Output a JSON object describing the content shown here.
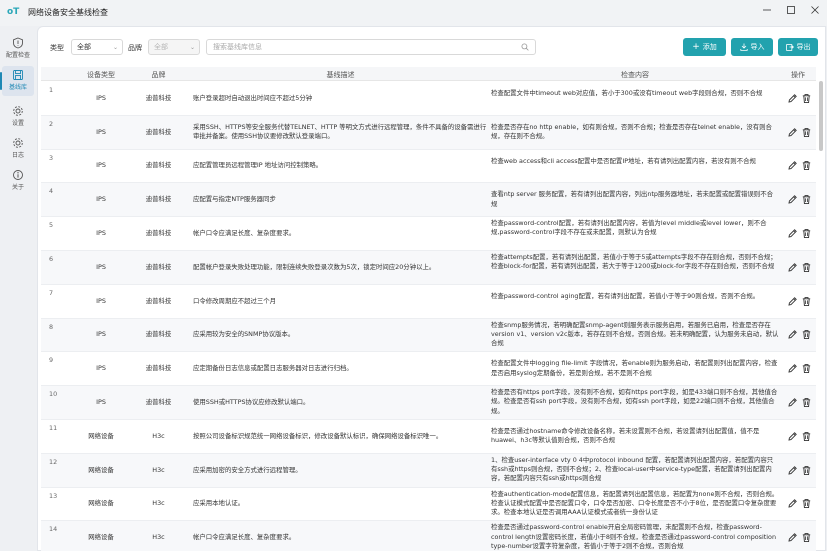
{
  "app": {
    "logo_text": "oT",
    "title": "网络设备安全基线检查"
  },
  "sidebar": {
    "items": [
      {
        "label": "配置检查",
        "icon": "shield-icon",
        "active": false
      },
      {
        "label": "基线库",
        "icon": "save-icon",
        "active": true
      },
      {
        "label": "设置",
        "icon": "gear-icon",
        "active": false
      },
      {
        "label": "日志",
        "icon": "gear-log-icon",
        "active": false
      },
      {
        "label": "关于",
        "icon": "info-icon",
        "active": false
      }
    ]
  },
  "filters": {
    "type_label": "类型",
    "type_value": "全部",
    "brand_label": "品牌",
    "brand_value": "全部",
    "search_placeholder": "搜索基线库信息"
  },
  "toolbar": {
    "add_label": "添加",
    "import_label": "导入",
    "export_label": "导出"
  },
  "colors": {
    "accent": "#22a2ae"
  },
  "table": {
    "headers": [
      "设备类型",
      "品牌",
      "基线描述",
      "检查内容",
      "操作"
    ],
    "rows": [
      {
        "idx": "1",
        "type": "IPS",
        "brand": "迪普科技",
        "desc": "账户登录超时自动退出时间应不超过5分钟",
        "check": "检查配置文件中timeout web对应值，若小于300或没有timeout web字段则合规，否则不合规"
      },
      {
        "idx": "2",
        "type": "IPS",
        "brand": "迪普科技",
        "desc": "采用SSH、HTTPS等安全服务代替TELNET、HTTP 等明文方式进行远程管理，条件不具备的设备需进行审批并备案。使用SSH协议要修改默认登录端口。",
        "check": "检查是否存在no http enable，如有则合规，否则不合规；检查是否存在telnet enable，没有则合规，存在则不合规。"
      },
      {
        "idx": "3",
        "type": "IPS",
        "brand": "迪普科技",
        "desc": "应配置管理员远程管理IP 地址访问控制策略。",
        "check": "检查web access和cli access配置中是否配置IP地址，若有请列出配置内容，若没有则不合规"
      },
      {
        "idx": "4",
        "type": "IPS",
        "brand": "迪普科技",
        "desc": "应配置与指定NTP服务器同步",
        "check": "查看ntp server 服务配置，若有请列出配置内容，列出ntp服务器地址，若未配置或配置错误则不合规"
      },
      {
        "idx": "5",
        "type": "IPS",
        "brand": "迪普科技",
        "desc": "帐户口令应满足长度、复杂度要求。",
        "check": "检查password-control配置，若有请列出配置内容，若值为level middle或level lower，则不合规,password-control字段不存在或未配置，则默认为合规"
      },
      {
        "idx": "6",
        "type": "IPS",
        "brand": "迪普科技",
        "desc": "配置帐户登录失败处理功能，限制连续失败登录次数为5次，锁定时间应20分钟以上。",
        "check": "检查attempts配置，若有请列出配置，若值小于等于5或attempts字段不存在则合规，否则不合规；检查block-for配置，若有请列出配置，若大于等于1200或block-for字段不存在则合规，否则不合规"
      },
      {
        "idx": "7",
        "type": "IPS",
        "brand": "迪普科技",
        "desc": "口令修改周期应不超过三个月",
        "check": "检查password-control aging配置，若有请列出配置，若值小于等于90则合规，否则不合规。"
      },
      {
        "idx": "8",
        "type": "IPS",
        "brand": "迪普科技",
        "desc": "应采用较为安全的SNMP协议版本。",
        "check": "检查snmp服务情况，若明确配置snmp-agent则服务表示服务启用，若服务已启用，检查是否存在version v1、version v2c版本，若存在则不合规，否则合规。若未明确配置，认为服务未启动，默认合规"
      },
      {
        "idx": "9",
        "type": "IPS",
        "brand": "迪普科技",
        "desc": "应定期备份日志信息或配置日志服务器对日志进行归档。",
        "check": "检查配置文件中logging file-limit 字段情况，若enable则为服务启动，若配置则列出配置内容，检查是否启用syslog定期备份，若是则合规，若不是则不合规"
      },
      {
        "idx": "10",
        "type": "IPS",
        "brand": "迪普科技",
        "desc": "使用SSH或HTTPS协议应修改默认端口。",
        "check": "检查是否有https port字段，没有则不合规，如有https port字段，如是433端口则不合规，其他值合规。检查是否有ssh port字段，没有则不合规，如有ssh port字段，如是22端口则不合规，其他值合规。"
      },
      {
        "idx": "11",
        "type": "网络设备",
        "brand": "H3c",
        "desc": "按照公司设备标识规范统一网络设备标识，修改设备默认标识，确保网络设备标识唯一。",
        "check": "检查是否通过hostname命令修改设备名称，若未设置则不合规，若设置请列出配置值，值不是huawei、h3c等默认值则合规，否则不合规"
      },
      {
        "idx": "12",
        "type": "网络设备",
        "brand": "H3c",
        "desc": "应采用加密的安全方式进行远程管理。",
        "check": "1、检查user-interface vty 0 4中protocol inbound 配置，若配置请列出配置内容，若配置内容只有ssh或https则合规，否则不合规；2、检查local-user中service-type配置，若配置请列出配置内容，若配置内容只有ssh或https则合规"
      },
      {
        "idx": "13",
        "type": "网络设备",
        "brand": "H3c",
        "desc": "应采用本地认证。",
        "check": "检查authentication-mode配置信息，若配置请列出配置信息，若配置为none则不合规，否则合规。检查认证模式配置中是否配置口令，口令是否加密、口令长度是否不小于8位，是否配置口令复杂度要求。检查本地认证是否调用AAA认证模式或者统一身份认证"
      },
      {
        "idx": "14",
        "type": "网络设备",
        "brand": "H3c",
        "desc": "帐户口令应满足长度、复杂度要求。",
        "check": "检查是否通过password-control enable开启全局密码管理，未配置则不合规，检查password-control length设置密码长度，若值小于8则不合规，检查是否通过password-control composition type-number设置字符复杂度，若值小于等于2则不合规，否则合规"
      }
    ]
  }
}
